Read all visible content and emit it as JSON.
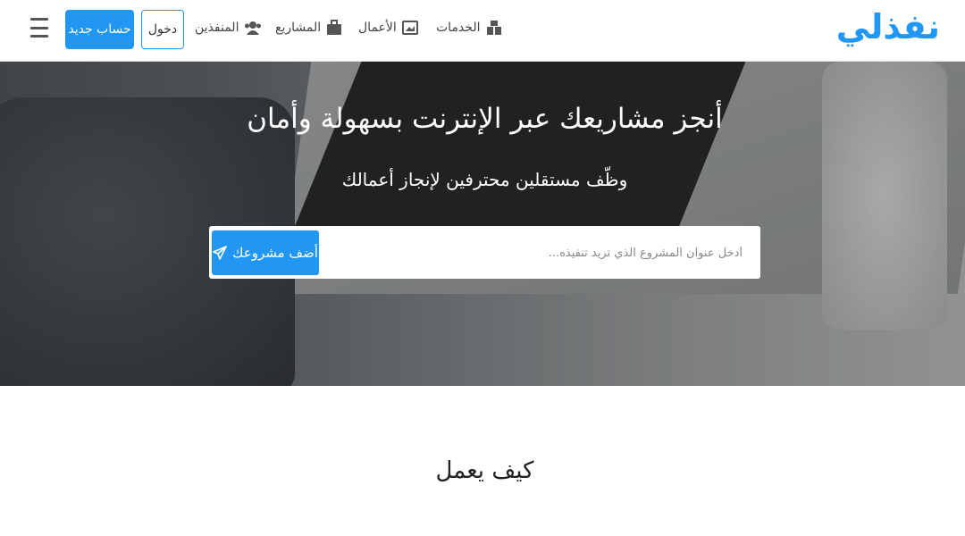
{
  "brand": {
    "logo_text": "نفذلي",
    "accent_color": "#2196f3"
  },
  "nav": {
    "items": [
      {
        "label": "الخدمات",
        "icon": "services-icon"
      },
      {
        "label": "الأعمال",
        "icon": "portfolio-icon"
      },
      {
        "label": "المشاريع",
        "icon": "briefcase-icon"
      },
      {
        "label": "المنفذين",
        "icon": "users-icon"
      }
    ],
    "login_label": "دخول",
    "signup_label": "حساب جديد",
    "menu_icon": "hamburger-icon"
  },
  "hero": {
    "title": "أنجز مشاريعك عبر الإنترنت بسهولة وأمان",
    "subtitle": "وظّف مستقلين محترفين لإنجاز أعمالك",
    "search_placeholder": "أدخل عنوان المشروع الذي تريد تنفيذه...",
    "add_project_label": "أضف مشروعك",
    "add_project_icon": "paper-plane-icon"
  },
  "how_it_works": {
    "title": "كيف يعمل"
  }
}
